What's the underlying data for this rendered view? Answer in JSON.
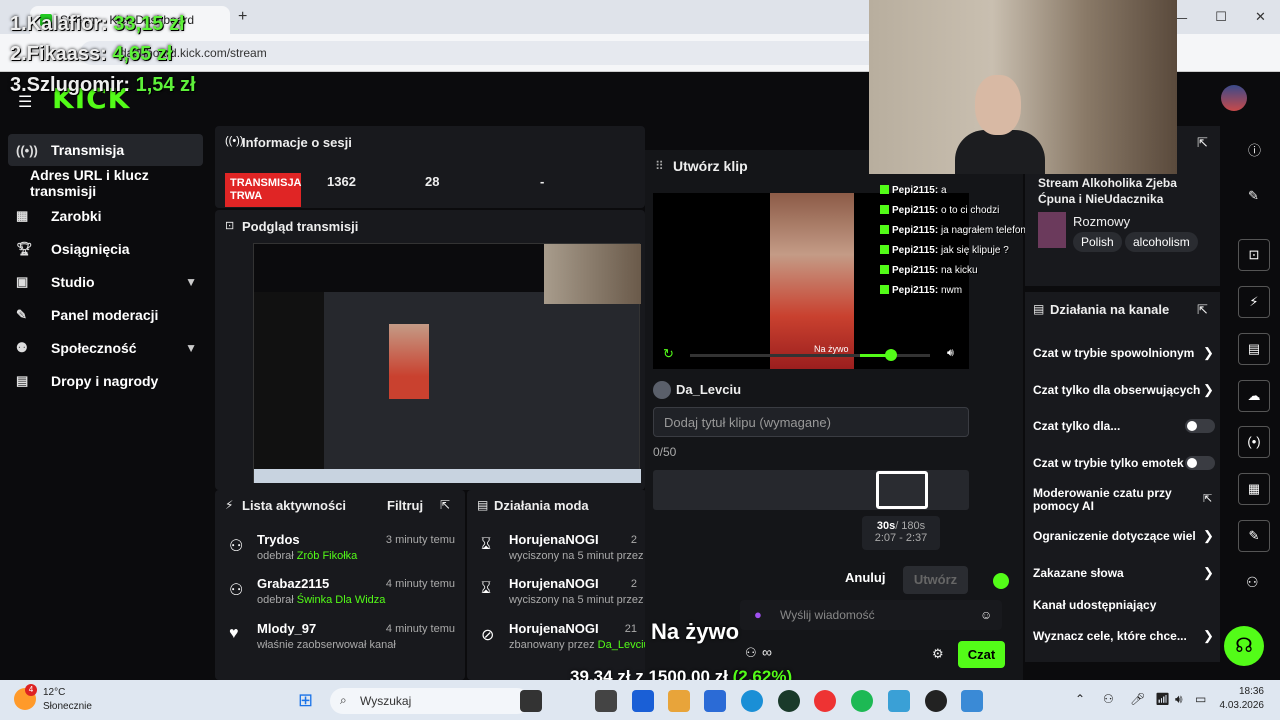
{
  "overlay": {
    "rank1_name": "1.Kalafior:",
    "rank1_val": "33,15 zł",
    "rank2_name": "2.Fikaass:",
    "rank2_val": "4,65 zł",
    "rank3_name": "3.Szlugomir:",
    "rank3_val": "1,54 zł",
    "goal_prefix": "39,34 zł",
    "goal_sep": " z ",
    "goal_total": "1500,00 zł",
    "goal_pct": "(2.62%)",
    "live_label": "Na żywo"
  },
  "browser": {
    "tab_title": "Stream - Kick Dashboard",
    "url": "dashboard.kick.com/stream"
  },
  "kick": {
    "logo": "KICK"
  },
  "sidebar": {
    "items": [
      {
        "label": "Transmisja",
        "icon": "broadcast-icon"
      },
      {
        "label": "Adres URL i klucz transmisji"
      },
      {
        "label": "Zarobki",
        "icon": "earnings-icon"
      },
      {
        "label": "Osiągnięcia",
        "icon": "trophy-icon"
      },
      {
        "label": "Studio",
        "icon": "studio-icon"
      },
      {
        "label": "Panel moderacji",
        "icon": "wrench-icon"
      },
      {
        "label": "Społeczność",
        "icon": "community-icon"
      },
      {
        "label": "Dropy i nagrody",
        "icon": "drops-icon"
      }
    ]
  },
  "session": {
    "title": "Informacje o sesji",
    "status": "TRANSMISJA TRWA",
    "stat1": "1362",
    "stat2": "28",
    "stat3": "-"
  },
  "preview": {
    "title": "Podgląd transmisji"
  },
  "activity": {
    "title": "Lista aktywności",
    "filter": "Filtruj",
    "rows": [
      {
        "name": "Trydos",
        "time": "3 minuty temu",
        "sub": "odebrał",
        "item": "Zrób Fikołka"
      },
      {
        "name": "Grabaz2115",
        "time": "4 minuty temu",
        "sub": "odebrał",
        "item": "Świnka Dla Widza"
      },
      {
        "name": "Mlody_97",
        "time": "4 minuty temu",
        "sub": "właśnie zaobserwował kanał",
        "item": ""
      }
    ]
  },
  "modactions": {
    "title": "Działania moda",
    "rows": [
      {
        "name": "HorujenaNOGI",
        "time": "2",
        "sub": "wyciszony na 5 minut przez"
      },
      {
        "name": "HorujenaNOGI",
        "time": "2",
        "sub": "wyciszony na 5 minut przez"
      },
      {
        "name": "HorujenaNOGI",
        "time": "21",
        "sub": "zbanowany przez",
        "by": "Da_Levciu"
      }
    ]
  },
  "clip": {
    "title": "Utwórz klip",
    "user": "Da_Levciu",
    "title_placeholder": "Dodaj tytuł klipu (wymagane)",
    "counter": "0/50",
    "duration_sel": "30s",
    "duration_max": "/ 180s",
    "range": "2:07 - 2:37",
    "cancel": "Anuluj",
    "create": "Utwórz",
    "video_label": "Na żywo"
  },
  "chat_messages": [
    {
      "user": "Pepi2115:",
      "text": "a"
    },
    {
      "user": "Pepi2115:",
      "text": "o to ci chodzi"
    },
    {
      "user": "Pepi2115:",
      "text": "ja nagrałem telefonem"
    },
    {
      "user": "Pepi2115:",
      "text": "jak się klipuje ?"
    },
    {
      "user": "Pepi2115:",
      "text": "na kicku"
    },
    {
      "user": "Pepi2115:",
      "text": "nwm"
    }
  ],
  "stream_info": {
    "title": "Stream Alkoholika Zjeba Ćpuna i NieUdacznika",
    "category": "Rozmowy",
    "tags": [
      "Polish",
      "alcoholism"
    ]
  },
  "channel_actions": {
    "title": "Działania na kanale",
    "items": [
      {
        "label": "Czat w trybie spowolnionym",
        "type": "chevron"
      },
      {
        "label": "Czat tylko dla obserwujących",
        "type": "chevron"
      },
      {
        "label": "Czat tylko dla...",
        "type": "toggle"
      },
      {
        "label": "Czat w trybie tylko emotek",
        "type": "toggle"
      },
      {
        "label": "Moderowanie czatu przy pomocy AI",
        "type": "external"
      },
      {
        "label": "Ograniczenie dotyczące wiel",
        "type": "chevron"
      },
      {
        "label": "Zakazane słowa",
        "type": "chevron"
      },
      {
        "label": "Kanał udostępniający",
        "type": "none"
      },
      {
        "label": "Wyznacz cele, które chce...",
        "type": "chevron"
      }
    ]
  },
  "chat_input": {
    "placeholder": "Wyślij wiadomość",
    "send": "Czat"
  },
  "taskbar": {
    "weather_temp": "12°C",
    "weather_desc": "Słonecznie",
    "search": "Wyszukaj",
    "time": "18:36",
    "date": "4.03.2026",
    "notif_count": "4"
  },
  "colors": {
    "brand": "#53fc18",
    "live": "#e02525"
  }
}
